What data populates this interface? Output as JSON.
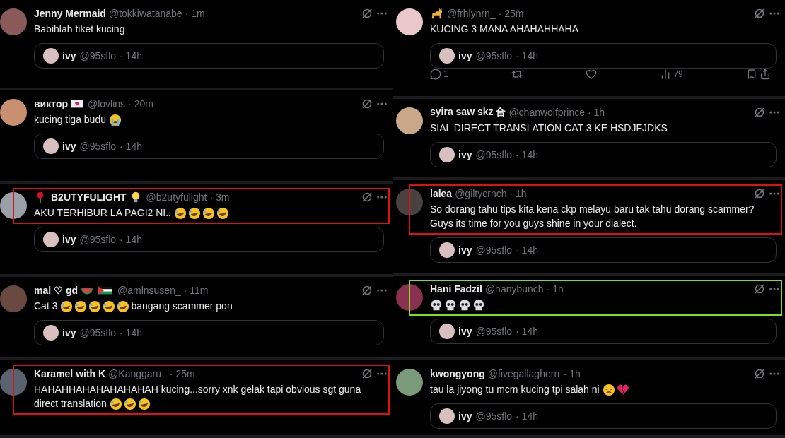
{
  "columns": [
    {
      "tweets": [
        {
          "name": [
            {
              "kind": "text",
              "text": "Jenny Mermaid"
            }
          ],
          "handle": "@tokkiwatanabe",
          "time": "· 1m",
          "content": [
            {
              "kind": "text",
              "text": "Babihlah tiket kucing"
            }
          ],
          "quote": {
            "name": "ivy",
            "handle": "@95sflo",
            "time": "· 14h"
          }
        },
        {
          "name": [
            {
              "kind": "text",
              "text": "виктор"
            },
            {
              "kind": "loveletter"
            }
          ],
          "handle": "@lovlins",
          "time": "· 20m",
          "content": [
            {
              "kind": "text",
              "text": "kucing tiga budu"
            },
            {
              "kind": "sob"
            }
          ],
          "quote": {
            "name": "ivy",
            "handle": "@95sflo",
            "time": "· 14h"
          }
        },
        {
          "name": [
            {
              "kind": "rose"
            },
            {
              "kind": "text",
              "text": "B2UTYFULIGHT"
            },
            {
              "kind": "bulb"
            }
          ],
          "handle": "@b2utyfulight",
          "time": "· 3m",
          "content": [
            {
              "kind": "text",
              "text": "AKU TERHIBUR LA PAGI2 NI.."
            },
            {
              "kind": "rofl"
            },
            {
              "kind": "rofl"
            },
            {
              "kind": "rofl"
            },
            {
              "kind": "rofl"
            }
          ],
          "quote": {
            "name": "ivy",
            "handle": "@95sflo",
            "time": "· 14h"
          },
          "color": "#e01010"
        },
        {
          "name": [
            {
              "kind": "text",
              "text": "mal ♡ gd"
            },
            {
              "kind": "watermelon"
            },
            {
              "kind": "flag"
            }
          ],
          "handle": "@amlnsusen_",
          "time": "· 11m",
          "content": [
            {
              "kind": "text",
              "text": "Cat 3"
            },
            {
              "kind": "rofl"
            },
            {
              "kind": "rofl"
            },
            {
              "kind": "rofl"
            },
            {
              "kind": "rofl"
            },
            {
              "kind": "rofl"
            },
            {
              "kind": "text",
              "text": "bangang scammer pon"
            }
          ],
          "quote": {
            "name": "ivy",
            "handle": "@95sflo",
            "time": "· 14h"
          }
        },
        {
          "name": [
            {
              "kind": "text",
              "text": "Karamel with K"
            }
          ],
          "handle": "@Kanggaru_",
          "time": "· 25m",
          "content": [
            {
              "kind": "text",
              "text": "HAHAHHAHAHAHAHAHAH kucing...sorry xnk gelak tapi obvious sgt guna"
            },
            {
              "kind": "text",
              "text": "direct translation"
            },
            {
              "kind": "rofl"
            },
            {
              "kind": "rofl"
            },
            {
              "kind": "rofl"
            }
          ],
          "color": "#e01010"
        }
      ]
    },
    {
      "tweets": [
        {
          "name": [
            {
              "kind": "cat"
            }
          ],
          "handle": "@frhlynrn_",
          "time": "· 25m",
          "content": [
            {
              "kind": "text",
              "text": "KUCING 3 MANA AHAHAHHAHA"
            }
          ],
          "quote": {
            "name": "ivy",
            "handle": "@95sflo",
            "time": "· 14h"
          },
          "actions": {
            "replies": "1",
            "views": "79"
          }
        },
        {
          "name": [
            {
              "kind": "text",
              "text": "syira saw skz 合"
            }
          ],
          "handle": "@chanwolfprince",
          "time": "· 1h",
          "content": [
            {
              "kind": "text",
              "text": "SIAL DIRECT TRANSLATION CAT 3 KE HSDJFJDKS"
            }
          ],
          "quote": {
            "name": "ivy",
            "handle": "@95sflo",
            "time": "· 14h"
          }
        },
        {
          "name": [
            {
              "kind": "text",
              "text": "lalea"
            }
          ],
          "handle": "@giltycrnch",
          "time": "· 1h",
          "content": [
            {
              "kind": "text",
              "text": "So dorang tahu tips kita kena ckp melayu baru tak tahu dorang scammer? Guys its time for you guys shine in your dialect."
            }
          ],
          "quote": {
            "name": "ivy",
            "handle": "@95sflo",
            "time": "· 14h"
          },
          "color": "#e01010"
        },
        {
          "name": [
            {
              "kind": "text",
              "text": "Hani Fadzil"
            }
          ],
          "handle": "@hanybunch",
          "time": "· 1h",
          "content": [
            {
              "kind": "skull"
            },
            {
              "kind": "skull"
            },
            {
              "kind": "skull"
            },
            {
              "kind": "skull"
            }
          ],
          "quote": {
            "name": "ivy",
            "handle": "@95sflo",
            "time": "· 14h"
          },
          "color": "#7ee01c"
        },
        {
          "name": [
            {
              "kind": "text",
              "text": "kwongyong"
            }
          ],
          "handle": "@fivegallagherrr",
          "time": "· 1h",
          "content": [
            {
              "kind": "text",
              "text": "tau la jiyong tu mcm kucing tpi salah ni"
            },
            {
              "kind": "disappointed"
            },
            {
              "kind": "brokenheart"
            }
          ],
          "quote": {
            "name": "ivy",
            "handle": "@95sflo",
            "time": "· 14h"
          }
        }
      ]
    }
  ]
}
